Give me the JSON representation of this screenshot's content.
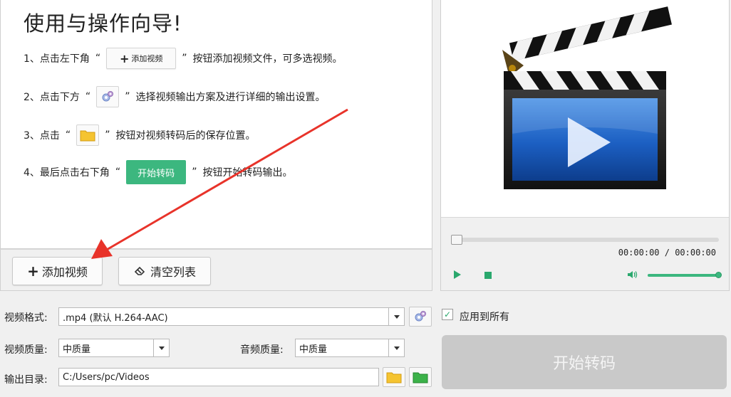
{
  "guide": {
    "title": "使用与操作向导!",
    "steps": {
      "s1": {
        "before": "1、点击左下角",
        "button": "添加视频",
        "after": "按钮添加视频文件，可多选视频。"
      },
      "s2": {
        "before": "2、点击下方",
        "after": "选择视频输出方案及进行详细的输出设置。"
      },
      "s3": {
        "before": "3、点击",
        "after": "按钮对视频转码后的保存位置。"
      },
      "s4": {
        "before": "4、最后点击右下角",
        "button": "开始转码",
        "after": "按钮开始转码输出。"
      }
    },
    "quote_open": "“",
    "quote_close": "”"
  },
  "list_bar": {
    "add_label": "添加视频",
    "clear_label": "清空列表"
  },
  "player": {
    "time": "00:00:00 / 00:00:00",
    "seek_fraction": 0,
    "volume_fraction": 1.0
  },
  "settings": {
    "format_label": "视频格式:",
    "format_value": ".mp4 (默认 H.264-AAC)",
    "video_quality_label": "视频质量:",
    "video_quality_value": "中质量",
    "audio_quality_label": "音频质量:",
    "audio_quality_value": "中质量",
    "output_label": "输出目录:",
    "output_value": "C:/Users/pc/Videos",
    "apply_all_label": "应用到所有",
    "apply_all_checked": true,
    "start_label": "开始转码"
  },
  "colors": {
    "accent_green": "#3cb77f",
    "arrow_red": "#e8332a",
    "disabled_button": "#c9c9c9"
  }
}
